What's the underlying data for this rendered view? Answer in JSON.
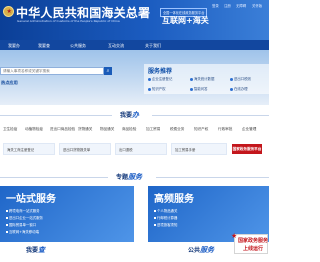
{
  "header": {
    "title": "中华人民共和国海关总署",
    "subtitle": "General Administration of Customs of the People's Republic of China",
    "platform_tag": "全国一体化在线政务服务平台",
    "platform_name": "互联网+海关",
    "top_links": [
      "登录",
      "注册",
      "无障碍",
      "关怀版"
    ]
  },
  "nav": {
    "items": [
      "我要办",
      "我要查",
      "公共服务",
      "互动交流",
      "关于我们"
    ]
  },
  "search": {
    "placeholder": "请输入事项名称或关键字搜索"
  },
  "hot": {
    "label": "热点应用"
  },
  "service_recommend": {
    "title": "服务推荐",
    "items": [
      "企业注册登记",
      "海关统计数据",
      "进出口税则",
      "知识产权",
      "智能问答",
      "在线办理"
    ]
  },
  "sections": {
    "ban": {
      "prefix": "我要",
      "accent": "办"
    },
    "topic": {
      "prefix": "专题",
      "accent": "服务"
    },
    "cha": {
      "prefix": "我要",
      "accent": "查"
    },
    "public": {
      "prefix": "公共",
      "accent": "服务"
    }
  },
  "service_row": [
    "卫生检疫",
    "动植物检疫",
    "进出口商品检验",
    "货物通关",
    "物品通关",
    "商品检验",
    "加工贸易",
    "税费业务",
    "知识产权",
    "行政审批",
    "企业管理"
  ],
  "cards": [
    "海关工商注册登记",
    "进出口货物报关单",
    "出口退税",
    "加工贸易手册",
    "国家政务服务平台"
  ],
  "big_cards": [
    {
      "title": "一站式服务",
      "links": [
        "跨境电商一站式服务",
        "进出口企业一站式服务",
        "国际贸易单一窗口",
        "互联网+海关移动端"
      ]
    },
    {
      "title": "高频服务",
      "links": [
        "个人物品通关",
        "行邮税计算器",
        "进境旅客须知"
      ]
    }
  ],
  "gov_badge": {
    "line1": "国家政务服务",
    "line2": "上线运行"
  },
  "colors": {
    "primary": "#1a5bb8",
    "nav": "#12479f",
    "accent_red": "#c3161c"
  }
}
